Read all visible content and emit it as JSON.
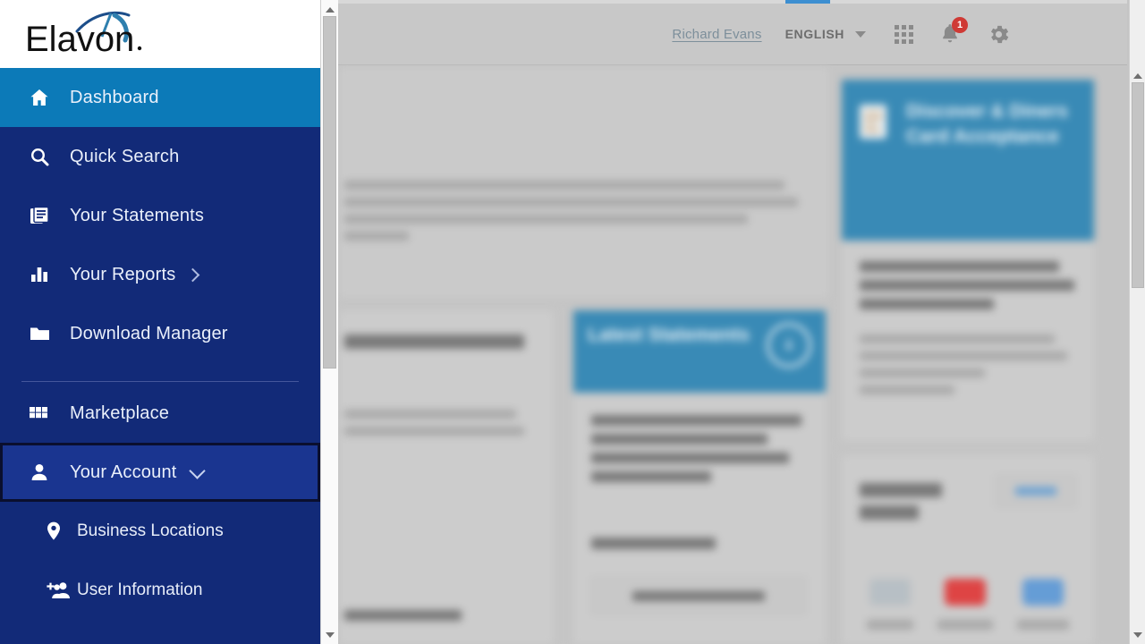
{
  "header": {
    "user_name": "Richard Evans",
    "language": "ENGLISH",
    "notification_count": "1",
    "apps_icon": "apps-grid-icon",
    "bell_icon": "notification-bell-icon",
    "gear_icon": "settings-gear-icon",
    "caret_icon": "chevron-down-icon"
  },
  "brand": {
    "logo_text": "Elavon",
    "logo_name": "elavon-logo"
  },
  "sidebar": {
    "items": [
      {
        "label": "Dashboard",
        "icon": "home-icon",
        "state": "active"
      },
      {
        "label": "Quick Search",
        "icon": "search-icon",
        "state": "default"
      },
      {
        "label": "Your Statements",
        "icon": "document-icon",
        "state": "default"
      },
      {
        "label": "Your Reports",
        "icon": "bar-chart-icon",
        "state": "default",
        "chevron": "chevron-right-icon"
      },
      {
        "label": "Download Manager",
        "icon": "folder-icon",
        "state": "default"
      },
      {
        "label": "Marketplace",
        "icon": "grid-icon",
        "state": "default"
      },
      {
        "label": "Your Account",
        "icon": "person-icon",
        "state": "focused",
        "chevron": "chevron-down-icon"
      }
    ],
    "sub_items": [
      {
        "label": "Business Locations",
        "icon": "map-pin-icon"
      },
      {
        "label": "User Information",
        "icon": "add-users-icon"
      }
    ]
  },
  "main": {
    "intro_lines": [
      "blurred-text-line-1",
      "blurred-text-line-2",
      "blurred-text-line-3",
      "blurred-text-line-4"
    ],
    "recent_activity": {
      "title": "Recent Activity",
      "body_lines": [
        "blurred-line-1",
        "blurred-line-2"
      ],
      "footer_link": "blurred-link"
    },
    "latest_statements": {
      "title": "Latest Statements",
      "icon": "download-circle-icon",
      "body_lines": [
        "blurred-line-1",
        "blurred-line-2",
        "blurred-line-3",
        "blurred-line-4"
      ],
      "link_label": "All Statements",
      "button_label": "DOWNLOAD"
    },
    "card_acceptance": {
      "title": "Discover & Diners Card Acceptance",
      "icon": "card-document-icon",
      "subtitle_lines": [
        "blurred-heading-1",
        "blurred-heading-2",
        "blurred-heading-3"
      ],
      "body_lines": [
        "blurred-body-1",
        "blurred-body-2",
        "blurred-body-3",
        "blurred-body-4"
      ]
    },
    "quick_links": {
      "title": "Quick Links",
      "edit_label": "EDIT",
      "links": [
        {
          "label": "link-one",
          "color": "#a9b6c0"
        },
        {
          "label": "link-two",
          "color": "#e03b3b"
        },
        {
          "label": "link-three",
          "color": "#4a90d9"
        }
      ]
    }
  },
  "scrollbars": {
    "inner": "inner-vertical-scrollbar",
    "outer": "outer-vertical-scrollbar",
    "up_arrow": "scroll-up-arrow",
    "down_arrow": "scroll-down-arrow"
  },
  "colors": {
    "brand_navy": "#122a78",
    "brand_active_blue": "#0c7ab8",
    "banner_blue": "#2f86b5",
    "badge_red": "#cf3a35"
  }
}
